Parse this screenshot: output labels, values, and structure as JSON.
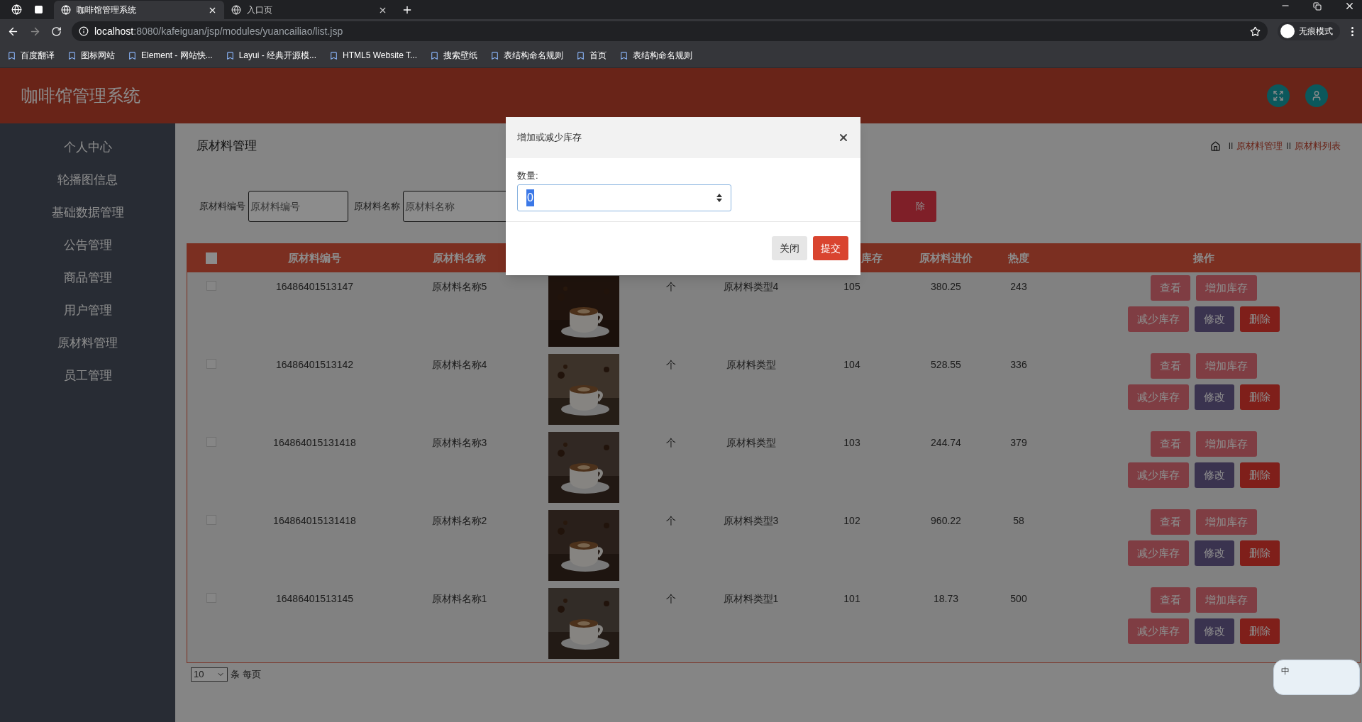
{
  "browser": {
    "tabs": [
      {
        "title": "咖啡馆管理系统",
        "selected": true
      },
      {
        "title": "入口页",
        "selected": false
      }
    ],
    "url": {
      "host": "localhost",
      "path": ":8080/kafeiguan/jsp/modules/yuancailiao/list.jsp"
    },
    "profile": "无痕模式",
    "bookmarks": [
      {
        "label": "百度翻译"
      },
      {
        "label": "图标网站"
      },
      {
        "label": "Element - 网站快..."
      },
      {
        "label": "Layui - 经典开源模..."
      },
      {
        "label": "HTML5 Website T..."
      },
      {
        "label": "搜索壁纸"
      },
      {
        "label": "表结构命名规则"
      },
      {
        "label": "首页"
      },
      {
        "label": "表结构命名规则"
      }
    ]
  },
  "app": {
    "title": "咖啡馆管理系统",
    "sidebar": {
      "items": [
        {
          "label": "个人中心"
        },
        {
          "label": "轮播图信息"
        },
        {
          "label": "基础数据管理"
        },
        {
          "label": "公告管理"
        },
        {
          "label": "商品管理"
        },
        {
          "label": "用户管理"
        },
        {
          "label": "原材料管理"
        },
        {
          "label": "员工管理"
        }
      ]
    },
    "page_title": "原材料管理",
    "breadcrumb": {
      "items": [
        {
          "separator": "II",
          "label": "原材料管理"
        },
        {
          "separator": "II",
          "label": "原材料列表"
        }
      ]
    },
    "search": {
      "fields": [
        {
          "label": "原材料编号",
          "placeholder": "原材料编号"
        },
        {
          "label": "原材料名称",
          "placeholder": "原材料名称"
        }
      ],
      "button": "除"
    },
    "table": {
      "select_all_checked": false,
      "columns": [
        "原材料编号",
        "原材料名称",
        "",
        "",
        "",
        "库存",
        "原材料进价",
        "热度",
        "操作"
      ],
      "rows": [
        {
          "checked": false,
          "cells": [
            "16486401513147",
            "原材料名称5",
            "",
            "个",
            "原材料类型4",
            "105",
            "380.25",
            "243"
          ],
          "actions": [
            {
              "label": "查看",
              "kind": "view"
            },
            {
              "label": "增加库存",
              "kind": "add"
            },
            {
              "label": "减少库存",
              "kind": "reduce"
            },
            {
              "label": "修改",
              "kind": "edit"
            },
            {
              "label": "删除",
              "kind": "delete"
            }
          ]
        },
        {
          "checked": false,
          "cells": [
            "16486401513142",
            "原材料名称4",
            "",
            "个",
            "原材料类型",
            "104",
            "528.55",
            "336"
          ],
          "actions": [
            {
              "label": "查看",
              "kind": "view"
            },
            {
              "label": "增加库存",
              "kind": "add"
            },
            {
              "label": "减少库存",
              "kind": "reduce"
            },
            {
              "label": "修改",
              "kind": "edit"
            },
            {
              "label": "删除",
              "kind": "delete"
            }
          ]
        },
        {
          "checked": false,
          "cells": [
            "164864015131418",
            "原材料名称3",
            "",
            "个",
            "原材料类型",
            "103",
            "244.74",
            "379"
          ],
          "actions": [
            {
              "label": "查看",
              "kind": "view"
            },
            {
              "label": "增加库存",
              "kind": "add"
            },
            {
              "label": "减少库存",
              "kind": "reduce"
            },
            {
              "label": "修改",
              "kind": "edit"
            },
            {
              "label": "删除",
              "kind": "delete"
            }
          ]
        },
        {
          "checked": false,
          "cells": [
            "164864015131418",
            "原材料名称2",
            "",
            "个",
            "原材料类型3",
            "102",
            "960.22",
            "58"
          ],
          "actions": [
            {
              "label": "查看",
              "kind": "view"
            },
            {
              "label": "增加库存",
              "kind": "add"
            },
            {
              "label": "减少库存",
              "kind": "reduce"
            },
            {
              "label": "修改",
              "kind": "edit"
            },
            {
              "label": "删除",
              "kind": "delete"
            }
          ]
        },
        {
          "checked": false,
          "cells": [
            "16486401513145",
            "原材料名称1",
            "",
            "个",
            "原材料类型1",
            "101",
            "18.73",
            "500"
          ],
          "actions": [
            {
              "label": "查看",
              "kind": "view"
            },
            {
              "label": "增加库存",
              "kind": "add"
            },
            {
              "label": "减少库存",
              "kind": "reduce"
            },
            {
              "label": "修改",
              "kind": "edit"
            },
            {
              "label": "删除",
              "kind": "delete"
            }
          ]
        }
      ]
    },
    "pagination": {
      "page_size": "10",
      "label": "条 每页"
    }
  },
  "modal": {
    "title": "增加或减少库存",
    "field": {
      "label": "数量:",
      "value": "0"
    },
    "buttons": [
      {
        "label": "关闭",
        "kind": "default"
      },
      {
        "label": "提交",
        "kind": "primary"
      }
    ]
  },
  "ime": {
    "label": "中"
  }
}
